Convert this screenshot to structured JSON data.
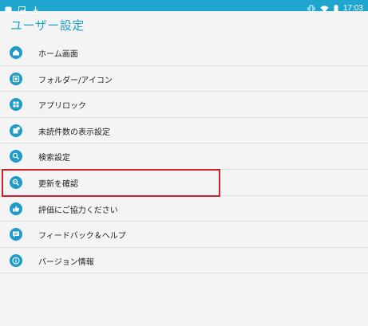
{
  "status_bar": {
    "time": "17:03",
    "left_icons": [
      "notification-box-icon",
      "image-icon",
      "download-icon"
    ],
    "right_icons": [
      "vibrate-icon",
      "wifi-icon",
      "battery-icon"
    ]
  },
  "header": {
    "title": "ユーザー設定"
  },
  "settings": {
    "items": [
      {
        "label": "ホーム画面",
        "icon": "home-icon"
      },
      {
        "label": "フォルダー/アイコン",
        "icon": "folder-icon"
      },
      {
        "label": "アプリロック",
        "icon": "grid-lock-icon"
      },
      {
        "label": "未読件数の表示設定",
        "icon": "badge-icon"
      },
      {
        "label": "検索設定",
        "icon": "search-icon"
      },
      {
        "label": "更新を確認",
        "icon": "update-search-icon"
      },
      {
        "label": "評価にご協力ください",
        "icon": "thumbs-up-icon"
      },
      {
        "label": "フィードバック＆ヘルプ",
        "icon": "feedback-icon"
      },
      {
        "label": "バージョン情報",
        "icon": "info-icon"
      }
    ]
  },
  "colors": {
    "accent": "#1ea0cc",
    "status_bar": "#1fa6cf",
    "highlight": "#d4202a"
  }
}
